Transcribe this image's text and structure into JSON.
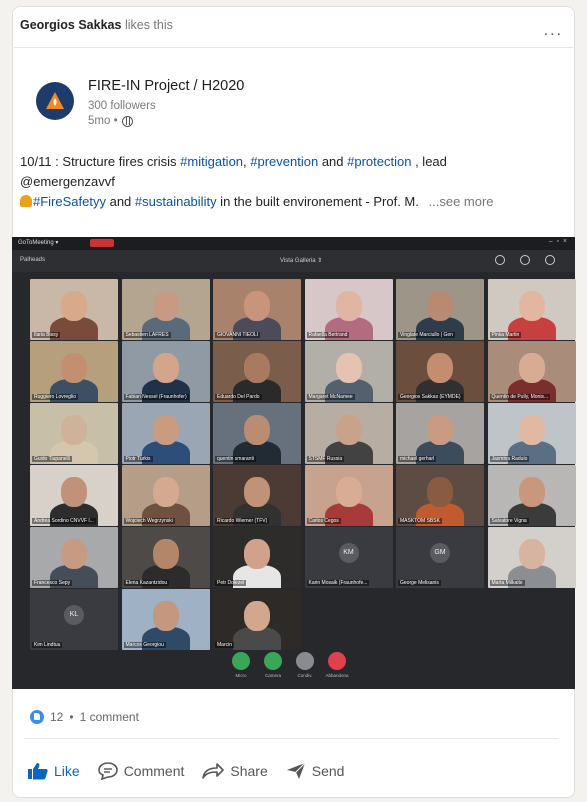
{
  "social_context": {
    "person": "Georgios Sakkas",
    "action": "likes this"
  },
  "more_menu": "...",
  "author": {
    "name": "FIRE-IN Project / H2020",
    "followers": "300 followers",
    "time": "5mo •"
  },
  "post": {
    "line1_prefix": "10/11 : Structure fires crisis ",
    "tag_mitigation": "#mitigation",
    "sep1": ", ",
    "tag_prevention": "#prevention",
    "and": " and ",
    "tag_protection": "#protection",
    "line1_suffix": " , lead",
    "mention": "@emergenzavvf",
    "tag_firesafety": "#FireSafetyy",
    "and2": " and ",
    "tag_sustainability": "#sustainability",
    "line3_suffix": " in the built environement - Prof. M.",
    "see_more": "...see more"
  },
  "meeting": {
    "app_name": "GoToMeeting ▾",
    "header_left": "Palheads",
    "header_mid": "Vista Galleria ⇕",
    "participants": [
      {
        "name": "Ilaria Bissy",
        "skin": "#d9a98c",
        "bg": "#c9b7a7",
        "shirt": "#7a4a3a"
      },
      {
        "name": "Sebastien LAFRES",
        "skin": "#c99a83",
        "bg": "#b3a58f",
        "shirt": "#5b6a7a"
      },
      {
        "name": "GIOVANNI TIEOLI",
        "skin": "#c8957c",
        "bg": "#a8826a",
        "shirt": "#4b4b5a"
      },
      {
        "name": "Rafaella Bertrand",
        "skin": "#e0b5a3",
        "bg": "#d7c7c9",
        "shirt": "#b36b80"
      },
      {
        "name": "Vinglate Marciullo | Gen",
        "skin": "#b88a72",
        "bg": "#9c9588",
        "shirt": "#2f3d4a"
      },
      {
        "name": "Pinka Martin",
        "skin": "#e2b6a0",
        "bg": "#cfc9c2",
        "shirt": "#c7403f"
      },
      {
        "name": "Ruggiero Lovreglio",
        "skin": "#c29071",
        "bg": "#b59f7d",
        "shirt": "#3d4f63"
      },
      {
        "name": "Fabian Nessel (Fraunhofer)",
        "skin": "#d4a58a",
        "bg": "#8f9aa5",
        "shirt": "#20314a"
      },
      {
        "name": "Eduardo Del Pardo",
        "skin": "#a97a60",
        "bg": "#7a5e4b",
        "shirt": "#2a2a2a"
      },
      {
        "name": "Margaret McNamee",
        "skin": "#e5c2b1",
        "bg": "#b2aea8",
        "shirt": "#54606e"
      },
      {
        "name": "Georgios Sakkas (EYMDE)",
        "skin": "#c48d6f",
        "bg": "#6b4e3e",
        "shirt": "#303030"
      },
      {
        "name": "Quentin de Pully, Monis...",
        "skin": "#d8ac93",
        "bg": "#a98d7a",
        "shirt": "#7a2e2e"
      },
      {
        "name": "Guido Tiupanelli",
        "skin": "#cfb29a",
        "bg": "#c8bfa9",
        "shirt": "#d4c7ad"
      },
      {
        "name": "Piotr Turkis",
        "skin": "#c99c80",
        "bg": "#9aa6b3",
        "shirt": "#2e4e7a"
      },
      {
        "name": "quentin smaranti",
        "skin": "#b98c73",
        "bg": "#66717d",
        "shirt": "#222a33"
      },
      {
        "name": "STSMF Russia",
        "skin": "#c9a28c",
        "bg": "#b8ada2",
        "shirt": "#424242"
      },
      {
        "name": "michael gerharl",
        "skin": "#c99b82",
        "bg": "#a6a3a0",
        "shirt": "#3b4c5d"
      },
      {
        "name": "Jasmina Radulo",
        "skin": "#e0b9a3",
        "bg": "#bfc4c9",
        "shirt": "#5a6f84"
      },
      {
        "name": "Andrea Sordino CNVVF l...",
        "skin": "#c2917a",
        "bg": "#d7d1c9",
        "shirt": "#2d2d2d"
      },
      {
        "name": "Wojciech Wegrzynski",
        "skin": "#d5a990",
        "bg": "#b59d88",
        "shirt": "#6e5140"
      },
      {
        "name": "Ricardo Wierner (TFV)",
        "skin": "#c09278",
        "bg": "#4c3b34",
        "shirt": "#313131"
      },
      {
        "name": "Carlos Cegos",
        "skin": "#d9ad95",
        "bg": "#c7a28e",
        "shirt": "#a93a3a"
      },
      {
        "name": "MASKTOM SBSK",
        "skin": "#8a5b43",
        "bg": "#5c4c43",
        "shirt": "#c15a2e"
      },
      {
        "name": "Salvatore Vigna",
        "skin": "#c8977c",
        "bg": "#b9b7b5",
        "shirt": "#3b3b3b"
      },
      {
        "name": "Francesco Sepy",
        "skin": "#c79a83",
        "bg": "#a8a9ab",
        "shirt": "#454e58"
      },
      {
        "name": "Elena Kazantzidou",
        "skin": "#b38569",
        "bg": "#4d4a47",
        "shirt": "#2c2c2c"
      },
      {
        "name": "Petr Dolezel",
        "skin": "#d0a28a",
        "bg": "#2e2c2b",
        "shirt": "#e6e6e6"
      },
      {
        "name": "Karin Mosaik (Fraunhofe...",
        "initials": "KM"
      },
      {
        "name": "George Melisanis",
        "initials": "GM"
      },
      {
        "name": "Marta Milkaite",
        "skin": "#d7b3a2",
        "bg": "#d3d0cc",
        "shirt": "#8b8f94"
      },
      {
        "name": "Kim Lindtuu",
        "initials": "KL"
      },
      {
        "name": "Marcos Georgiou",
        "skin": "#c4977e",
        "bg": "#9fb1c4",
        "shirt": "#2f4a67"
      },
      {
        "name": "Marcin",
        "skin": "#d3a78e",
        "bg": "#2d2a28",
        "shirt": "#4a4a4a"
      }
    ],
    "controls": [
      {
        "label": "Micro",
        "color": "#3aa657"
      },
      {
        "label": "Camera",
        "color": "#3aa657"
      },
      {
        "label": "Condiv.",
        "color": "#8a8b90"
      },
      {
        "label": "Abbandona",
        "color": "#e0424b"
      }
    ]
  },
  "reactions": {
    "count": "12",
    "comments": "1 comment"
  },
  "actions": {
    "like": "Like",
    "comment": "Comment",
    "share": "Share",
    "send": "Send"
  },
  "colors": {
    "link": "#0a52a4",
    "like_active": "#0a66c2",
    "meeting_bg": "#27282c"
  }
}
